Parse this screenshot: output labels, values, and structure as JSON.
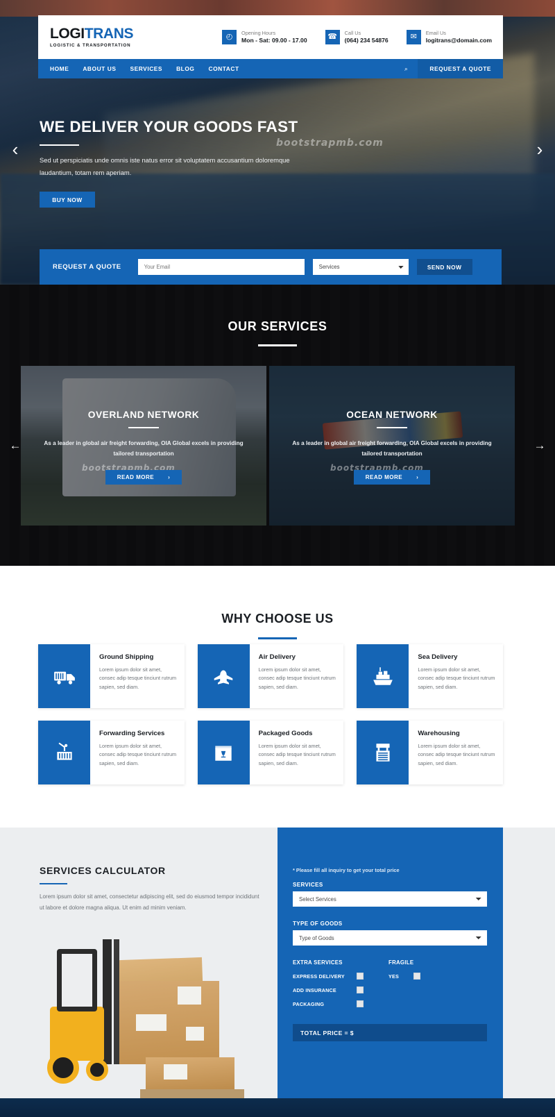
{
  "header": {
    "logo_main_a": "LOGI",
    "logo_main_b": "TRANS",
    "logo_sub": "LOGISTIC & TRANSPORTATION",
    "contacts": [
      {
        "icon": "clock-icon",
        "glyph": "◴",
        "label": "Opening Hours",
        "value": "Mon - Sat: 09.00 - 17.00"
      },
      {
        "icon": "phone-icon",
        "glyph": "☎",
        "label": "Call Us",
        "value": "(064) 234 54876"
      },
      {
        "icon": "envelope-icon",
        "glyph": "✉",
        "label": "Email Us",
        "value": "logitrans@domain.com"
      }
    ]
  },
  "nav": {
    "items": [
      "HOME",
      "ABOUT US",
      "SERVICES",
      "BLOG",
      "CONTACT"
    ],
    "search_glyph": "⌕",
    "quote_label": "REQUEST A QUOTE"
  },
  "hero": {
    "title": "WE DELIVER YOUR GOODS FAST",
    "paragraph": "Sed ut perspiciatis unde omnis iste natus error sit voluptatem accusantium doloremque laudantium, totam rem aperiam.",
    "button": "BUY NOW",
    "prev_glyph": "‹",
    "next_glyph": "›",
    "watermark": "bootstrapmb.com"
  },
  "quotebar": {
    "label": "REQUEST A QUOTE",
    "email_placeholder": "Your Email",
    "service_selected": "Services",
    "send_label": "SEND NOW"
  },
  "services": {
    "title": "OUR SERVICES",
    "prev_glyph": "←",
    "next_glyph": "→",
    "watermark": "bootstrapmb.com",
    "cards": [
      {
        "name": "OVERLAND NETWORK",
        "desc": "As a leader in global air freight forwarding, OIA Global excels in providing tailored transportation",
        "button": "READ MORE",
        "button_glyph": "›"
      },
      {
        "name": "OCEAN NETWORK",
        "desc": "As a leader in global air freight forwarding, OIA Global excels in providing tailored transportation",
        "button": "READ MORE",
        "button_glyph": "›"
      }
    ]
  },
  "why": {
    "title": "WHY CHOOSE US",
    "cards": [
      {
        "icon": "truck-icon",
        "title": "Ground Shipping",
        "desc": "Lorem ipsum dolor sit amet, consec adip tesque tinciunt rutrum sapien, sed diam."
      },
      {
        "icon": "airplane-icon",
        "title": "Air Delivery",
        "desc": "Lorem ipsum dolor sit amet, consec adip tesque tinciunt rutrum sapien, sed diam."
      },
      {
        "icon": "cargo-ship-icon",
        "title": "Sea Delivery",
        "desc": "Lorem ipsum dolor sit amet, consec adip tesque tinciunt rutrum sapien, sed diam."
      },
      {
        "icon": "crane-container-icon",
        "title": "Forwarding Services",
        "desc": "Lorem ipsum dolor sit amet, consec adip tesque tinciunt rutrum sapien, sed diam."
      },
      {
        "icon": "fragile-box-icon",
        "title": "Packaged Goods",
        "desc": "Lorem ipsum dolor sit amet, consec adip tesque tinciunt rutrum sapien, sed diam."
      },
      {
        "icon": "warehouse-icon",
        "title": "Warehousing",
        "desc": "Lorem ipsum dolor sit amet, consec adip tesque tinciunt rutrum sapien, sed diam."
      }
    ]
  },
  "calculator": {
    "title": "SERVICES CALCULATOR",
    "paragraph": "Lorem ipsum dolor sit amet, consectetur adipiscing elit, sed do eiusmod tempor incididunt ut labore et dolore magna aliqua. Ut enim ad minim veniam.",
    "note": "* Please fill all inquiry to get your total price",
    "services_label": "SERVICES",
    "services_selected": "Select Services",
    "goods_label": "TYPE OF GOODS",
    "goods_selected": "Type of Goods",
    "extra_heading": "EXTRA SERVICES",
    "fragile_heading": "FRAGILE",
    "extra_items": [
      "EXPRESS DELIVERY",
      "ADD INSURANCE",
      "PACKAGING"
    ],
    "fragile_items": [
      "YES"
    ],
    "total_label": "TOTAL PRICE = $"
  },
  "colors": {
    "brand_blue": "#1565b5",
    "dark_blue": "#0f4c8c",
    "dark_section": "#0d0d10"
  }
}
